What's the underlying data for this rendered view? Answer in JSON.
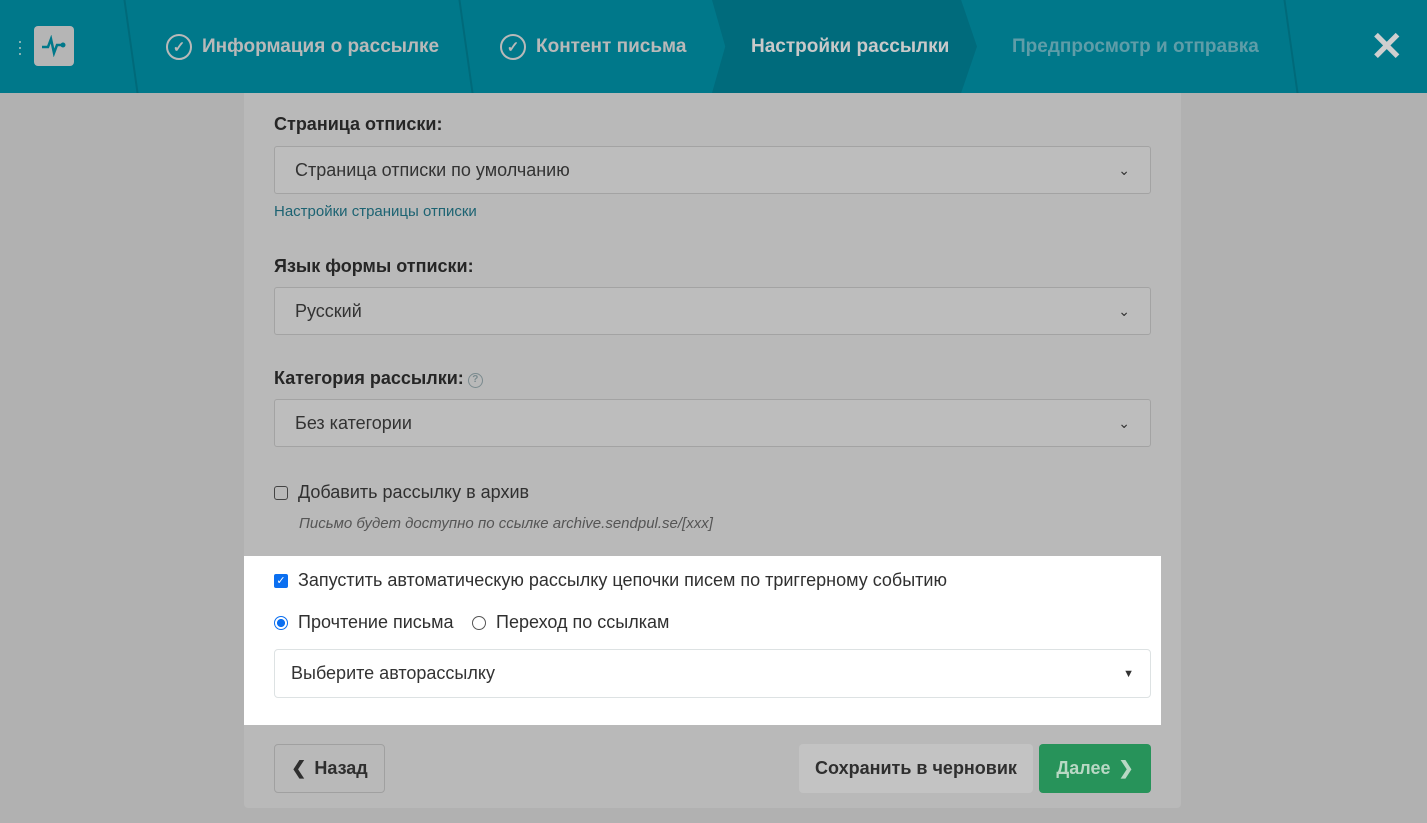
{
  "header": {
    "steps": [
      {
        "label": "Информация о рассылке",
        "status": "done"
      },
      {
        "label": "Контент письма",
        "status": "done"
      },
      {
        "label": "Настройки рассылки",
        "status": "active"
      },
      {
        "label": "Предпросмотр и отправка",
        "status": "pending"
      }
    ]
  },
  "form": {
    "unsubscribe_page": {
      "label": "Страница отписки:",
      "value": "Страница отписки по умолчанию",
      "link": "Настройки страницы отписки"
    },
    "unsubscribe_lang": {
      "label": "Язык формы отписки:",
      "value": "Русский"
    },
    "category": {
      "label": "Категория рассылки:",
      "value": "Без категории"
    },
    "archive": {
      "label": "Добавить рассылку в архив",
      "checked": false,
      "hint": "Письмо будет доступно по ссылке archive.sendpul.se/[xxx]"
    },
    "trigger": {
      "label": "Запустить автоматическую рассылку цепочки писем по триггерному событию",
      "checked": true,
      "options": [
        {
          "label": "Прочтение письма",
          "selected": true
        },
        {
          "label": "Переход по ссылкам",
          "selected": false
        }
      ],
      "autoresponder_placeholder": "Выберите авторассылку"
    }
  },
  "footer": {
    "back": "Назад",
    "save_draft": "Сохранить в черновик",
    "next": "Далее"
  },
  "colors": {
    "header": "#00788a",
    "accent": "#0b6ff0",
    "next": "#27935a"
  }
}
